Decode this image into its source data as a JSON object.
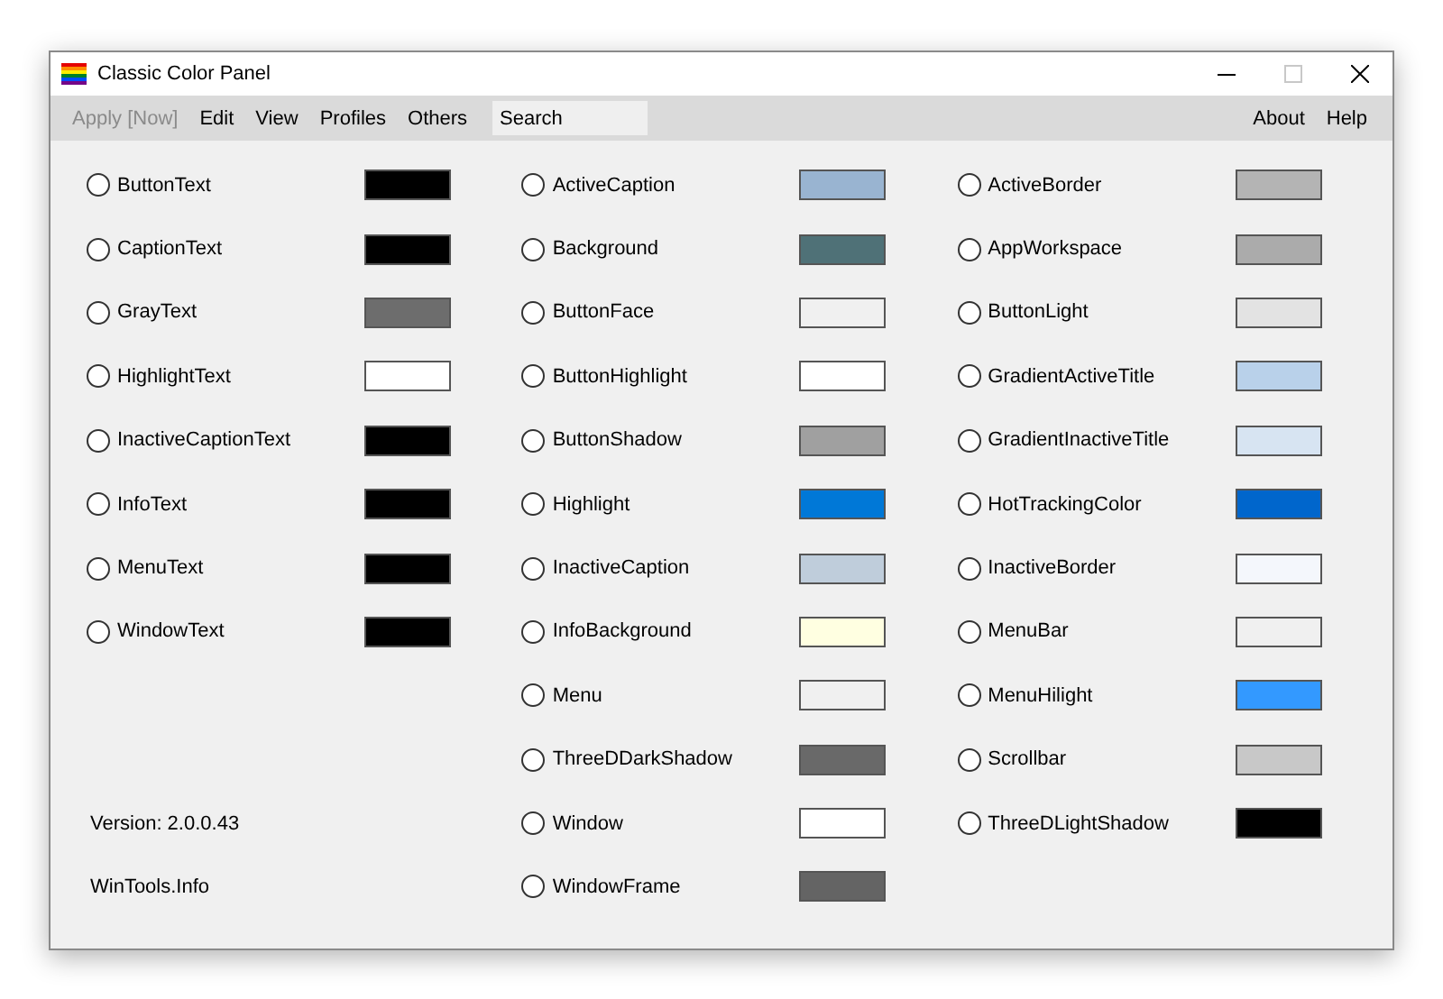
{
  "window": {
    "title": "Classic Color Panel",
    "controls": [
      {
        "kind": "minimize",
        "disabled": false
      },
      {
        "kind": "maximize",
        "disabled": true
      },
      {
        "kind": "close",
        "disabled": false
      }
    ]
  },
  "menu_left": [
    {
      "label": "Apply [Now]",
      "disabled": true
    },
    {
      "label": "Edit",
      "disabled": false
    },
    {
      "label": "View",
      "disabled": false
    },
    {
      "label": "Profiles",
      "disabled": false
    },
    {
      "label": "Others",
      "disabled": false
    }
  ],
  "search": {
    "placeholder": "Search"
  },
  "menu_right": [
    {
      "label": "About",
      "disabled": false
    },
    {
      "label": "Help",
      "disabled": false
    }
  ],
  "columns": [
    [
      {
        "name": "ButtonText",
        "selected": false,
        "color": "#000000"
      },
      {
        "name": "CaptionText",
        "selected": false,
        "color": "#000000"
      },
      {
        "name": "GrayText",
        "selected": false,
        "color": "#6d6d6d"
      },
      {
        "name": "HighlightText",
        "selected": false,
        "color": "#ffffff"
      },
      {
        "name": "InactiveCaptionText",
        "selected": false,
        "color": "#000000"
      },
      {
        "name": "InfoText",
        "selected": false,
        "color": "#000000"
      },
      {
        "name": "MenuText",
        "selected": false,
        "color": "#000000"
      },
      {
        "name": "WindowText",
        "selected": false,
        "color": "#000000"
      }
    ],
    [
      {
        "name": "ActiveCaption",
        "selected": false,
        "color": "#99b4d1"
      },
      {
        "name": "Background",
        "selected": false,
        "color": "#4f7177"
      },
      {
        "name": "ButtonFace",
        "selected": false,
        "color": "#f0f0f0"
      },
      {
        "name": "ButtonHighlight",
        "selected": false,
        "color": "#ffffff"
      },
      {
        "name": "ButtonShadow",
        "selected": false,
        "color": "#a0a0a0"
      },
      {
        "name": "Highlight",
        "selected": false,
        "color": "#0078d7"
      },
      {
        "name": "InactiveCaption",
        "selected": false,
        "color": "#bfcddb"
      },
      {
        "name": "InfoBackground",
        "selected": false,
        "color": "#ffffe1"
      },
      {
        "name": "Menu",
        "selected": false,
        "color": "#f0f0f0"
      },
      {
        "name": "ThreeDDarkShadow",
        "selected": false,
        "color": "#696969"
      },
      {
        "name": "Window",
        "selected": false,
        "color": "#ffffff"
      },
      {
        "name": "WindowFrame",
        "selected": false,
        "color": "#646464"
      }
    ],
    [
      {
        "name": "ActiveBorder",
        "selected": false,
        "color": "#b4b4b4"
      },
      {
        "name": "AppWorkspace",
        "selected": false,
        "color": "#ababab"
      },
      {
        "name": "ButtonLight",
        "selected": false,
        "color": "#e3e3e3"
      },
      {
        "name": "GradientActiveTitle",
        "selected": false,
        "color": "#b9d1ea"
      },
      {
        "name": "GradientInactiveTitle",
        "selected": false,
        "color": "#d7e4f2"
      },
      {
        "name": "HotTrackingColor",
        "selected": false,
        "color": "#0066cc"
      },
      {
        "name": "InactiveBorder",
        "selected": false,
        "color": "#f4f7fc"
      },
      {
        "name": "MenuBar",
        "selected": false,
        "color": "#f0f0f0"
      },
      {
        "name": "MenuHilight",
        "selected": false,
        "color": "#3399ff"
      },
      {
        "name": "Scrollbar",
        "selected": false,
        "color": "#c8c8c8"
      },
      {
        "name": "ThreeDLightShadow",
        "selected": false,
        "color": "#000000"
      }
    ]
  ],
  "footer": [
    "Version: 2.0.0.43",
    "WinTools.Info"
  ]
}
